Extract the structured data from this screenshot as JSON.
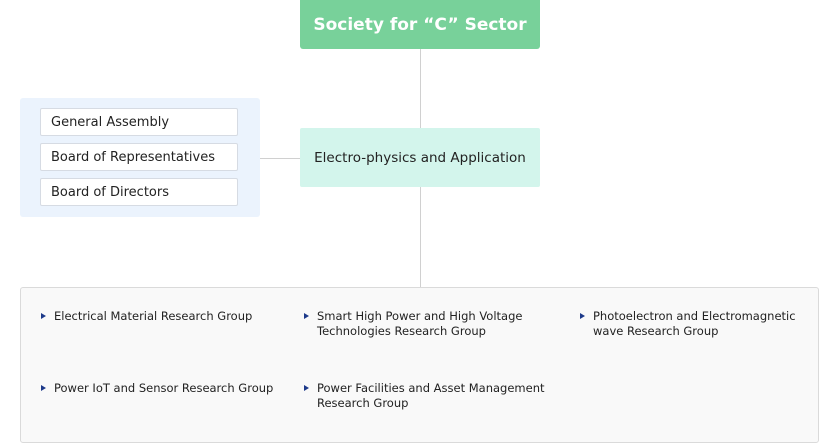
{
  "society": {
    "title": "Society for “C” Sector"
  },
  "division": {
    "title": "Electro-physics and Application"
  },
  "boards": [
    {
      "label": "General Assembly"
    },
    {
      "label": "Board of Representatives"
    },
    {
      "label": "Board of Directors"
    }
  ],
  "groups": [
    {
      "lines": [
        "Electrical Material Research Group"
      ]
    },
    {
      "lines": [
        "Smart High Power and High Voltage",
        "Technologies Research Group"
      ]
    },
    {
      "lines": [
        "Photoelectron and Electromagnetic",
        "wave Research Group"
      ]
    },
    {
      "lines": [
        "Power IoT and Sensor Research Group"
      ]
    },
    {
      "lines": [
        "Power Facilities and Asset Management",
        "Research Group"
      ]
    }
  ],
  "colors": {
    "top_box": "#78d19a",
    "mid_box": "#d3f5ec",
    "board_panel": "#ebf3fd",
    "bullet": "#1d3a8a"
  }
}
